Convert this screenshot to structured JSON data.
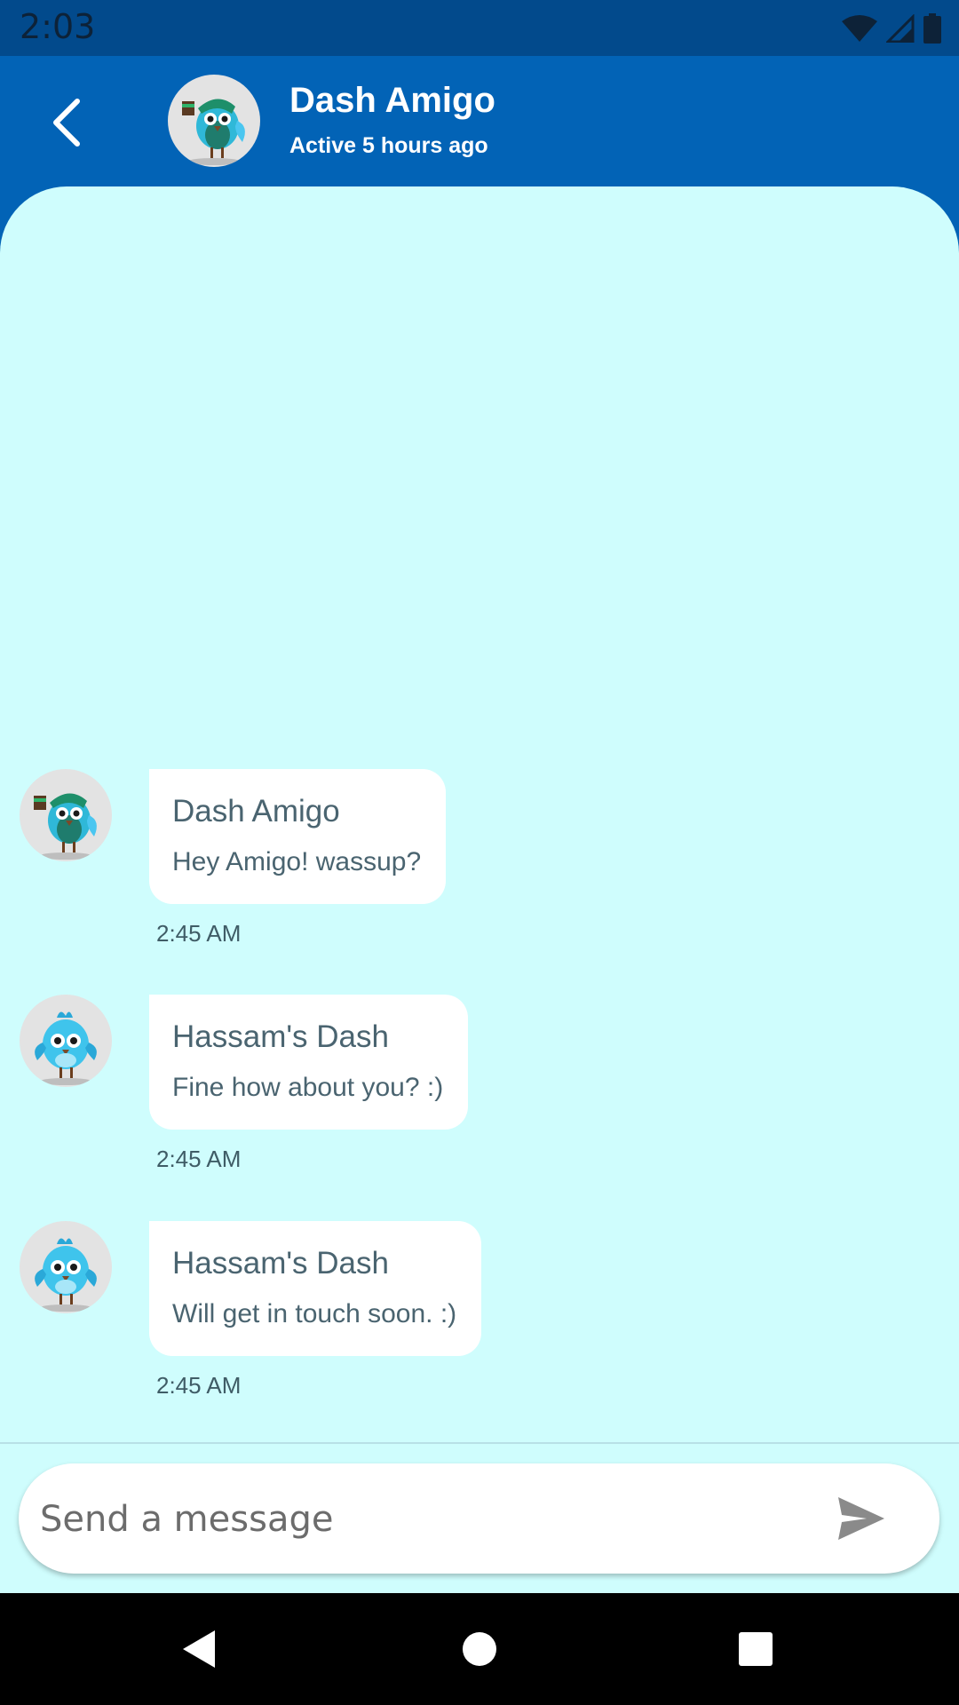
{
  "status_bar": {
    "time": "2:03"
  },
  "header": {
    "name": "Dash Amigo",
    "status": "Active 5 hours ago"
  },
  "messages": [
    {
      "sender": "Dash Amigo",
      "text": "Hey Amigo! wassup?",
      "time": "2:45 AM",
      "avatar": "dash-amigo-avatar"
    },
    {
      "sender": "Hassam's Dash",
      "text": "Fine how about you? :)",
      "time": "2:45 AM",
      "avatar": "hassams-dash-avatar"
    },
    {
      "sender": "Hassam's Dash",
      "text": "Will get in touch soon. :)",
      "time": "2:45 AM",
      "avatar": "hassams-dash-avatar"
    }
  ],
  "composer": {
    "placeholder": "Send a message",
    "value": ""
  },
  "colors": {
    "header": "#0263b6",
    "status_bar": "#024a8c",
    "chat_background": "#cffdfd",
    "bubble": "#ffffff",
    "text": "#4a6470"
  },
  "icons": [
    "back-arrow-icon",
    "wifi-icon",
    "signal-icon",
    "battery-icon",
    "send-icon",
    "nav-back-icon",
    "nav-home-icon",
    "nav-recents-icon"
  ]
}
